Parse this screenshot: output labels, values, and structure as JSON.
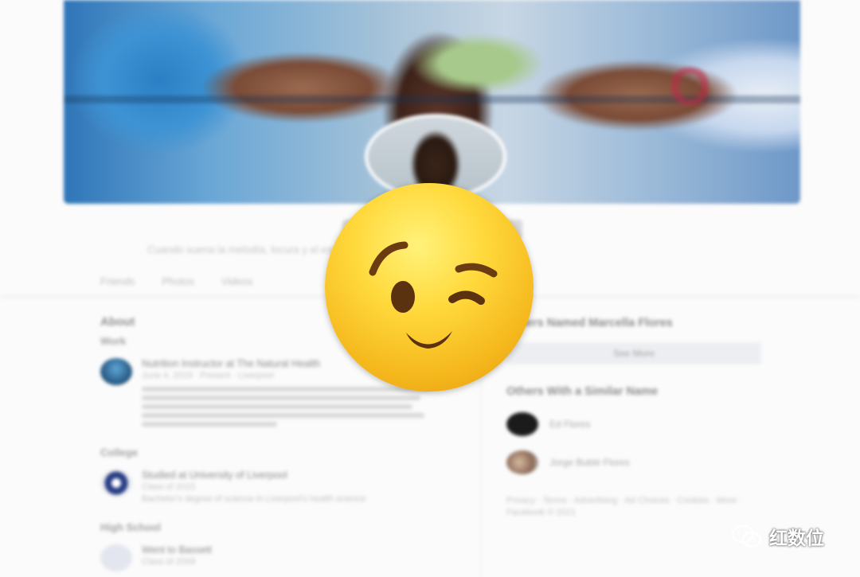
{
  "profile": {
    "bio": "Cuando suena la melodía, locura y el espíritu comienza a bailar",
    "tabs": [
      "Friends",
      "Photos",
      "Videos"
    ]
  },
  "about": {
    "heading": "About",
    "work_label": "Work",
    "work_title": "Nutrition Instructor at The Natural Health",
    "work_meta": "June 4, 2019 · Present · Liverpool",
    "college_label": "College",
    "college_title": "Studied at University of Liverpool",
    "college_meta": "Class of 2015",
    "college_desc": "Bachelor's degree of science in Liverpool's health science",
    "hs_label": "High School",
    "hs_title": "Went to Bassett",
    "hs_meta": "Class of 2009"
  },
  "sidebar": {
    "heading": "Others Named Marcella Flores",
    "see_more": "See More",
    "similar_heading": "Others With a Similar Name",
    "people": [
      "Ed Flores",
      "Jorge Bublé Flores"
    ],
    "footer": "Privacy · Terms · Advertising · Ad Choices · Cookies · More · Facebook © 2021"
  },
  "watermark": {
    "text": "红数位",
    "icon": "wechat-logo-icon"
  },
  "overlay": {
    "icon": "winking-face-emoji-icon"
  }
}
